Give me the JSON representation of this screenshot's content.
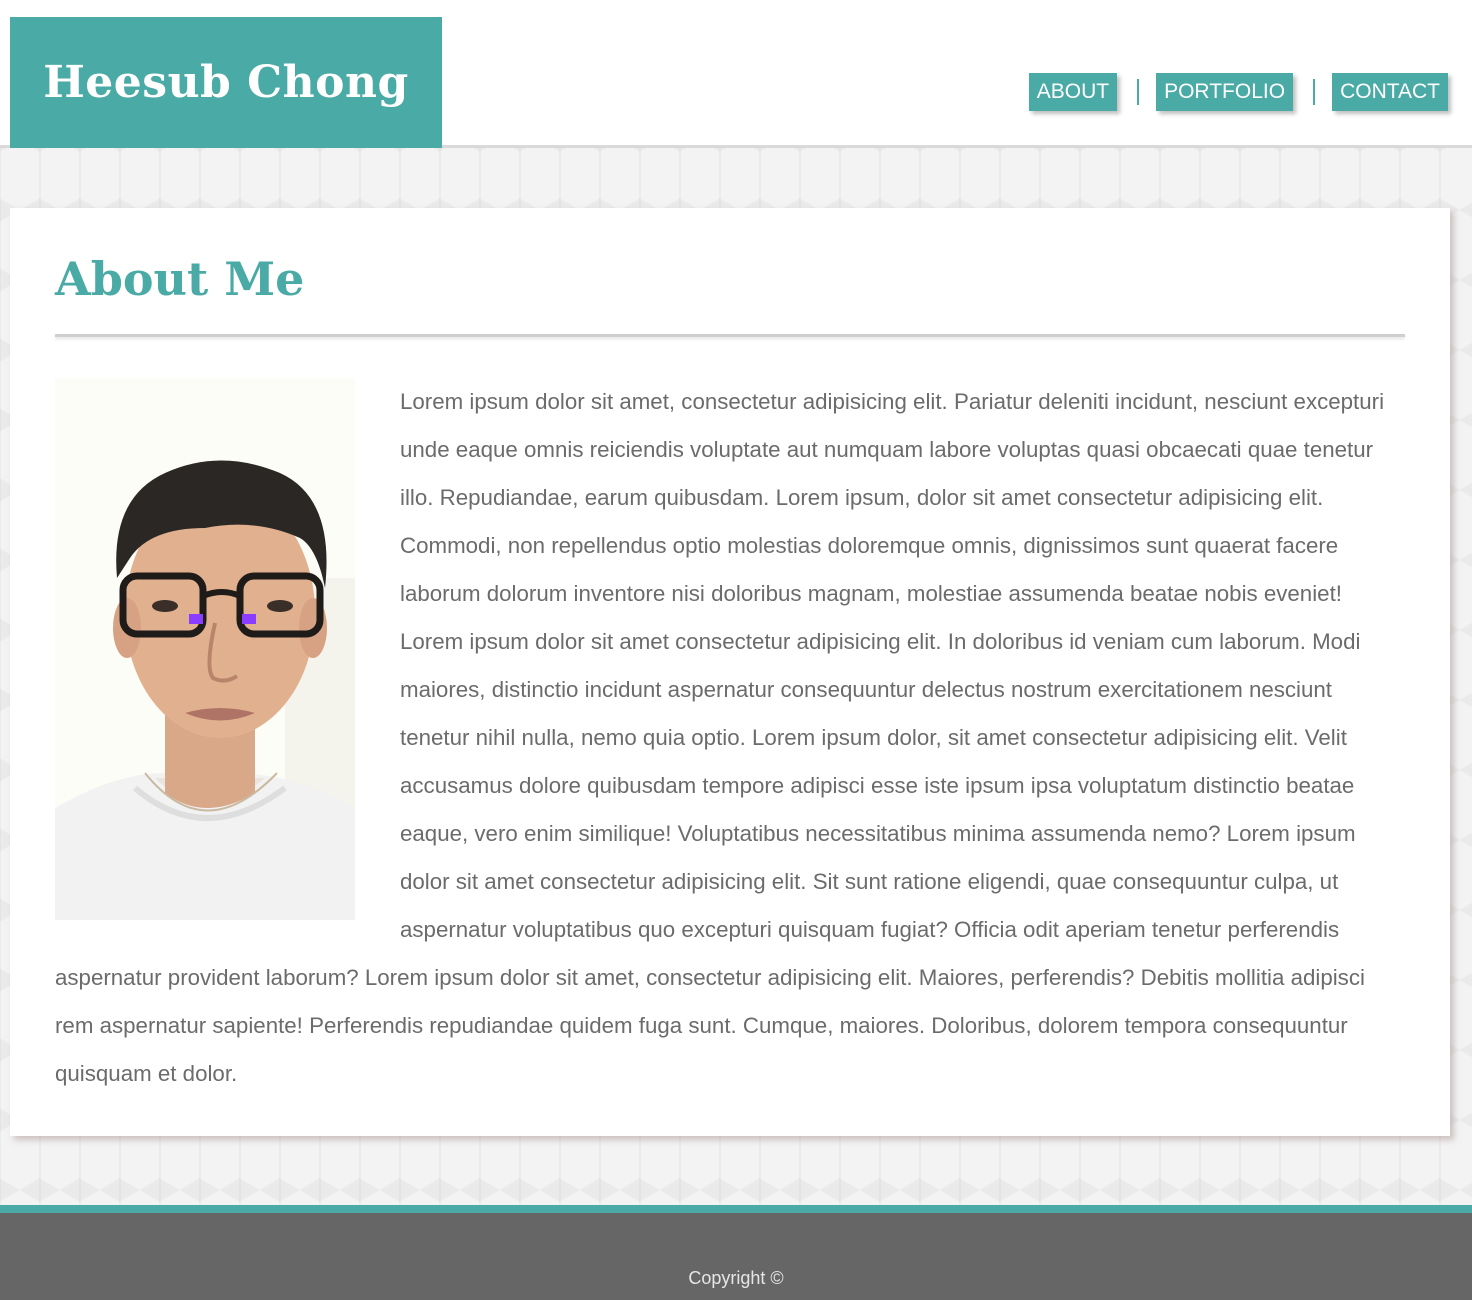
{
  "header": {
    "logo_text": "Heesub Chong",
    "nav": [
      {
        "label": "ABOUT"
      },
      {
        "label": "PORTFOLIO"
      },
      {
        "label": "CONTACT"
      }
    ]
  },
  "main": {
    "title": "About Me",
    "photo_icon": "profile-photo",
    "body_text": "Lorem ipsum dolor sit amet, consectetur adipisicing elit. Pariatur deleniti incidunt, nesciunt excepturi unde eaque omnis reiciendis voluptate aut numquam labore voluptas quasi obcaecati quae tenetur illo. Repudiandae, earum quibusdam. Lorem ipsum, dolor sit amet consectetur adipisicing elit. Commodi, non repellendus optio molestias doloremque omnis, dignissimos sunt quaerat facere laborum dolorum inventore nisi doloribus magnam, molestiae assumenda beatae nobis eveniet! Lorem ipsum dolor sit amet consectetur adipisicing elit. In doloribus id veniam cum laborum. Modi maiores, distinctio incidunt aspernatur consequuntur delectus nostrum exercitationem nesciunt tenetur nihil nulla, nemo quia optio. Lorem ipsum dolor, sit amet consectetur adipisicing elit. Velit accusamus dolore quibusdam tempore adipisci esse iste ipsum ipsa voluptatum distinctio beatae eaque, vero enim similique! Voluptatibus necessitatibus minima assumenda nemo? Lorem ipsum dolor sit amet consectetur adipisicing elit. Sit sunt ratione eligendi, quae consequuntur culpa, ut aspernatur voluptatibus quo excepturi quisquam fugiat? Officia odit aperiam tenetur perferendis aspernatur provident laborum? Lorem ipsum dolor sit amet, consectetur adipisicing elit. Maiores, perferendis? Debitis mollitia adipisci rem aspernatur sapiente! Perferendis repudiandae quidem fuga sunt. Cumque, maiores. Doloribus, dolorem tempora consequuntur quisquam et dolor."
  },
  "footer": {
    "copyright": "Copyright ©"
  },
  "colors": {
    "accent": "#4aaaa5",
    "footer_bg": "#666666",
    "text": "#6b6b6b"
  }
}
